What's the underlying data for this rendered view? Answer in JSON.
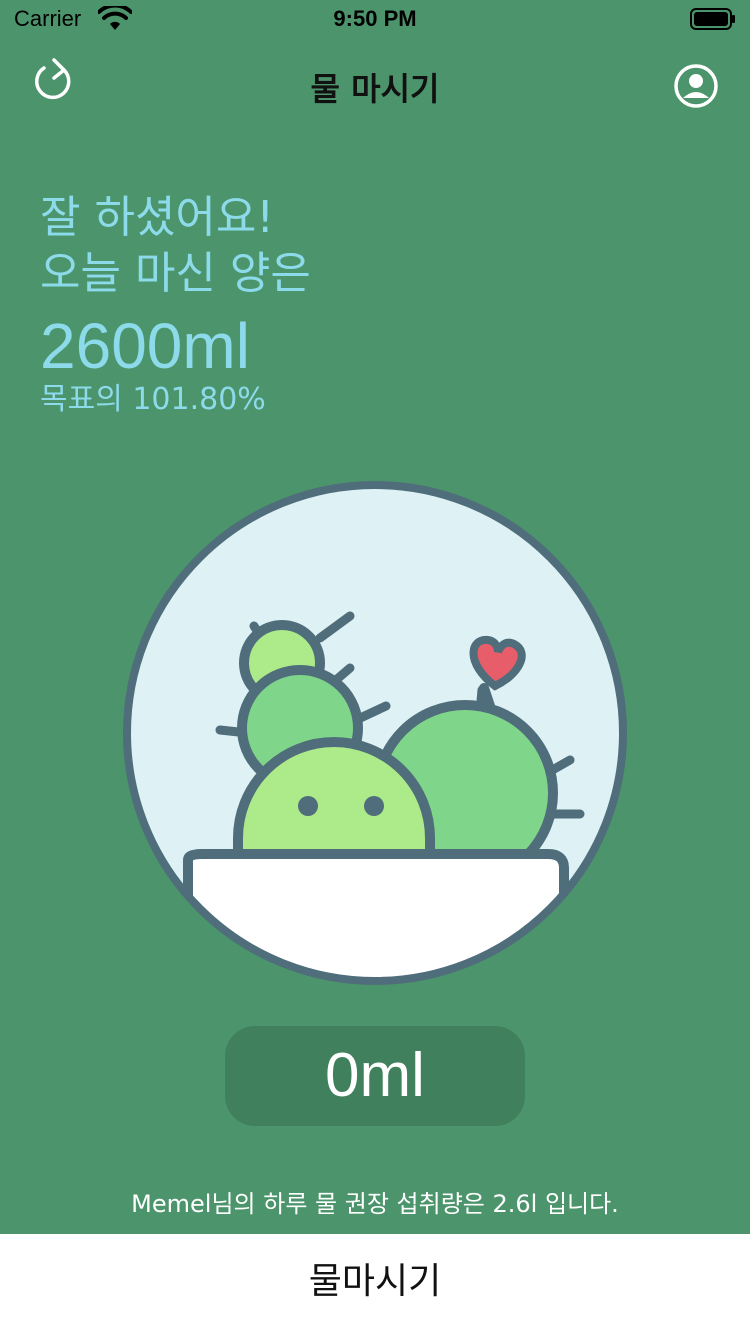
{
  "status_bar": {
    "carrier": "Carrier",
    "time": "9:50 PM"
  },
  "nav": {
    "title": "물 마시기",
    "left_icon": "refresh-icon",
    "right_icon": "profile-icon"
  },
  "summary": {
    "greeting": "잘 하셨어요!",
    "subtitle": "오늘 마신 양은",
    "total_amount": "2600ml",
    "goal_percent": "목표의 101.80%"
  },
  "illustration": {
    "name": "cactus-pot",
    "background": "#def1f4",
    "outline": "#4f6d7a",
    "cactus_light": "#acea8a",
    "cactus_mid": "#7fd68a",
    "heart": "#e85d6a"
  },
  "add_button": {
    "label": "0ml"
  },
  "recommendation": {
    "text": "Memel님의 하루 물 권장 섭취량은 2.6l 입니다."
  },
  "bottom_button": {
    "label": "물마시기"
  },
  "colors": {
    "background": "#4c956c",
    "accent_text": "#8ddaeb",
    "button_bg": "#41805d"
  }
}
